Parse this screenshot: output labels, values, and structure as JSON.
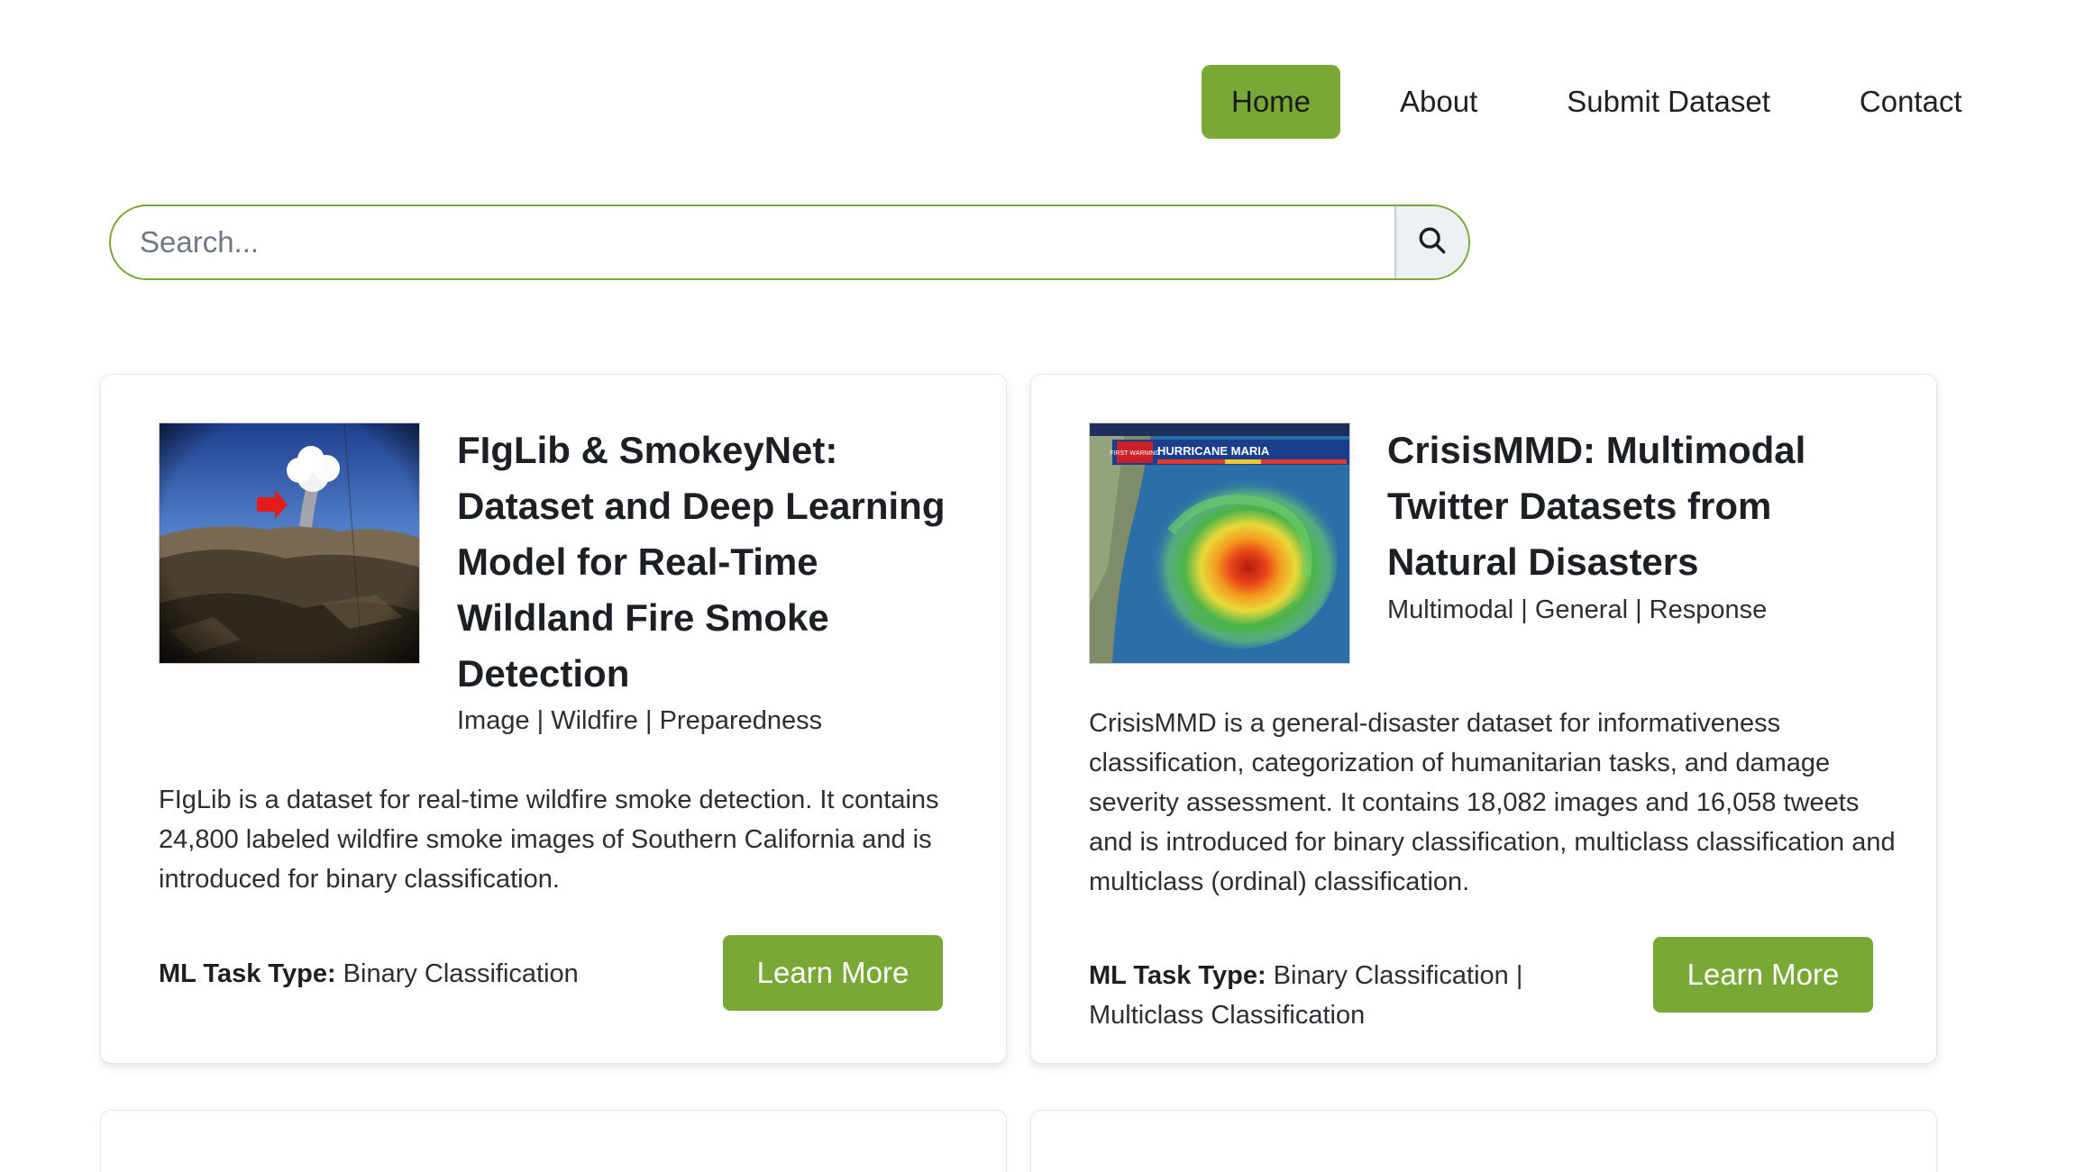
{
  "nav": {
    "items": [
      {
        "label": "Home",
        "active": true
      },
      {
        "label": "About",
        "active": false
      },
      {
        "label": "Submit Dataset",
        "active": false
      },
      {
        "label": "Contact",
        "active": false
      }
    ]
  },
  "search": {
    "placeholder": "Search...",
    "button_icon": "search-icon"
  },
  "colors": {
    "accent": "#7aa837"
  },
  "cards": [
    {
      "title": "FIgLib & SmokeyNet: Dataset and Deep Learning Model for Real-Time Wildland Fire Smoke Detection",
      "tags": "Image | Wildfire | Preparedness",
      "description": "FIgLib is a dataset for real-time wildfire smoke detection. It contains 24,800 labeled wildfire smoke images of Southern California and is introduced for binary classification.",
      "ml_label": "ML Task Type:",
      "ml_value": " Binary Classification",
      "button": "Learn More"
    },
    {
      "title": "CrisisMMD: Multimodal Twitter Datasets from Natural Disasters",
      "tags": "Multimodal | General | Response",
      "description": "CrisisMMD is a general-disaster dataset for informativeness classification, categorization of humanitarian tasks, and damage severity assessment. It contains 18,082 images and 16,058 tweets and is introduced for binary classification, multiclass classification and multiclass (ordinal) classification.",
      "ml_label": "ML Task Type:",
      "ml_value": " Binary Classification | Multiclass Classification",
      "button": "Learn More",
      "thumb_text": {
        "banner": "HURRICANE MARIA",
        "badge": "FIRST WARNING"
      }
    }
  ]
}
